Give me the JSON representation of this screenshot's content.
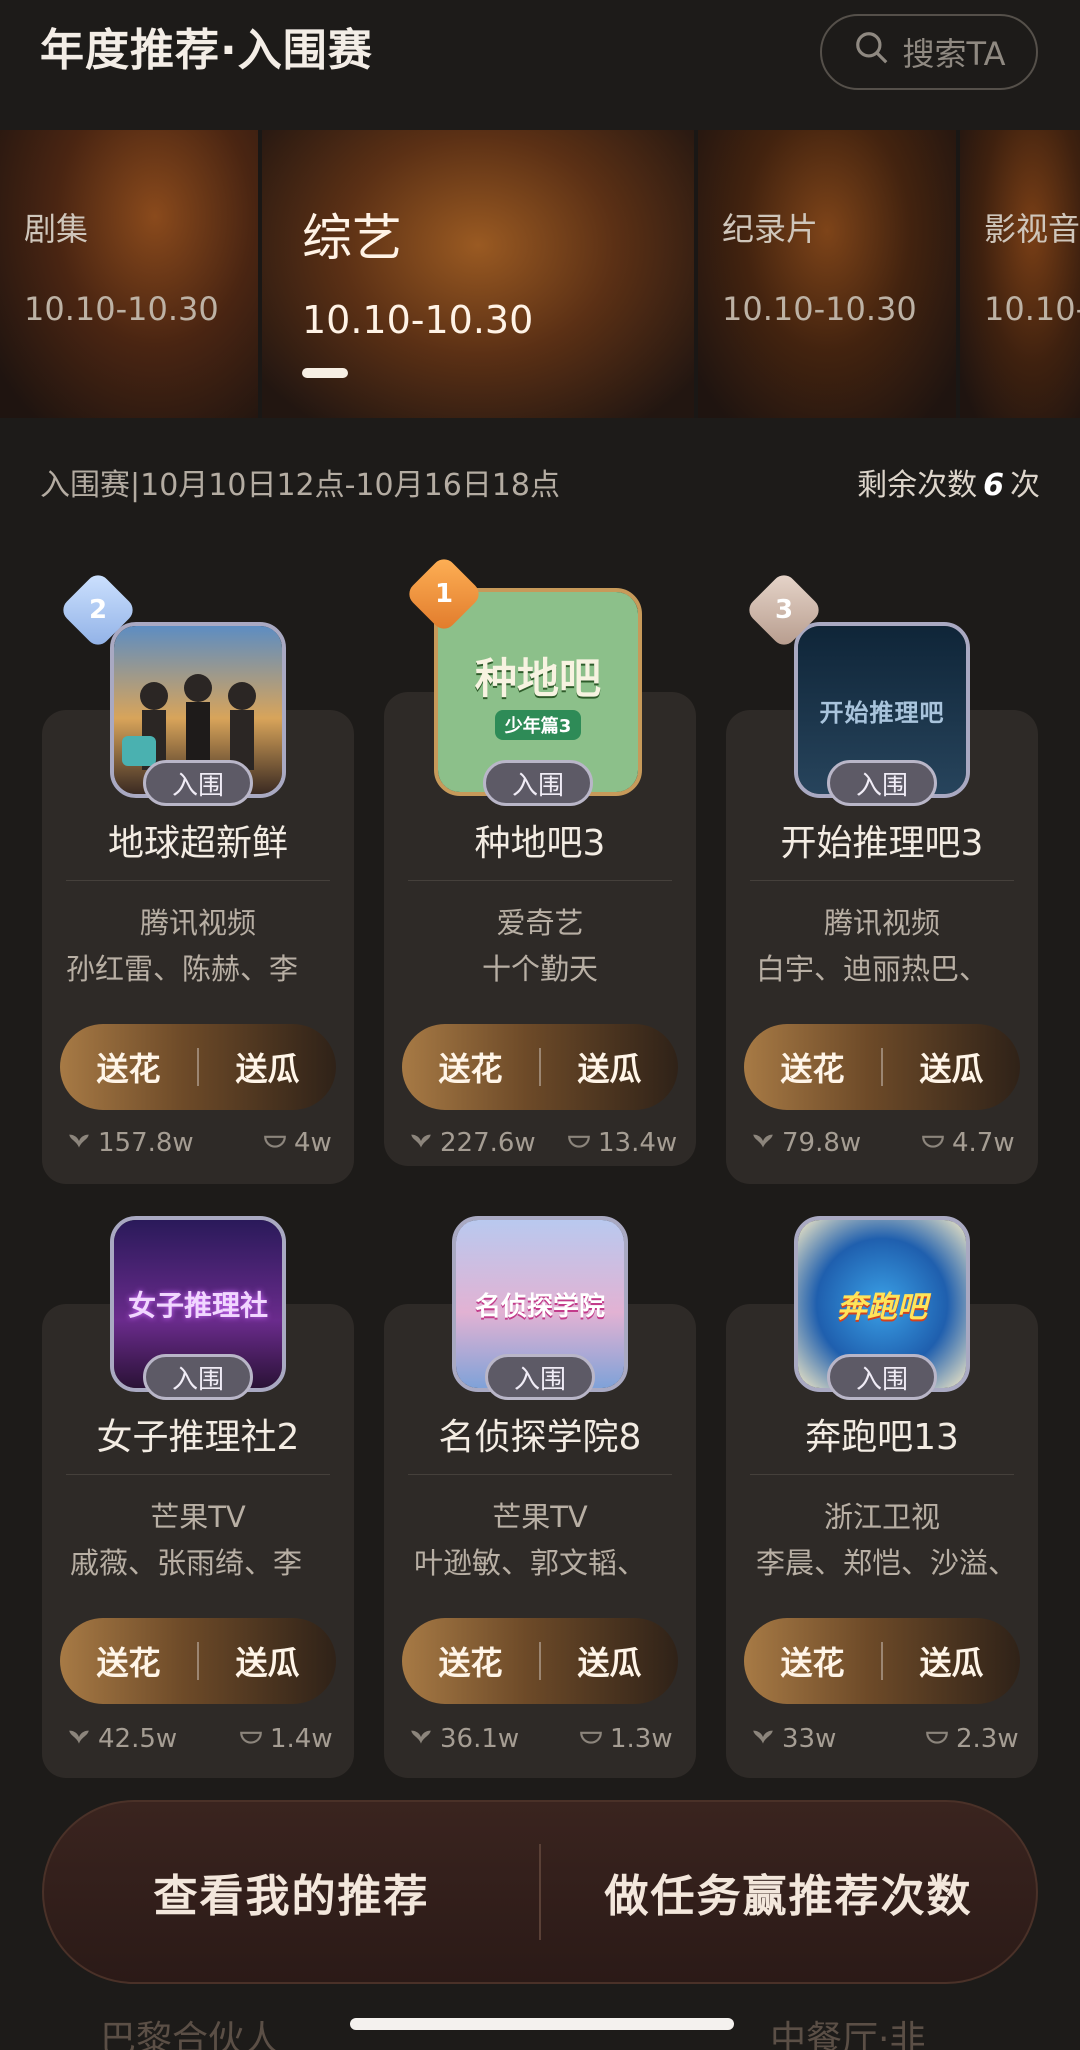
{
  "header": {
    "title": "年度推荐·入围赛",
    "search_label": "搜索TA"
  },
  "tabs": [
    {
      "label": "剧集",
      "date": "10.10-10.30"
    },
    {
      "label": "综艺",
      "date": "10.10-10.30",
      "active": true
    },
    {
      "label": "纪录片",
      "date": "10.10-10.30"
    },
    {
      "label": "影视音",
      "date": "10.10-"
    }
  ],
  "info": {
    "period": "入围赛|10月10日12点-10月16日18点",
    "remaining_label": "剩余次数",
    "remaining_count": "6",
    "remaining_unit": "次"
  },
  "cards": [
    {
      "rank": "2",
      "badge": "入围",
      "title": "地球超新鲜",
      "platform": "腾讯视频",
      "cast": "孙红雷、陈赫、李",
      "flower": "送花",
      "melon": "送瓜",
      "flower_count": "157.8w",
      "melon_count": "4w"
    },
    {
      "rank": "1",
      "badge": "入围",
      "title": "种地吧3",
      "platform": "爱奇艺",
      "cast": "十个勤天",
      "flower": "送花",
      "melon": "送瓜",
      "flower_count": "227.6w",
      "melon_count": "13.4w",
      "poster_text": "种地吧",
      "poster_sub": "少年篇3"
    },
    {
      "rank": "3",
      "badge": "入围",
      "title": "开始推理吧3",
      "platform": "腾讯视频",
      "cast": "白宇、迪丽热巴、",
      "flower": "送花",
      "melon": "送瓜",
      "flower_count": "79.8w",
      "melon_count": "4.7w",
      "poster_text": "开始推理吧"
    },
    {
      "badge": "入围",
      "title": "女子推理社2",
      "platform": "芒果TV",
      "cast": "戚薇、张雨绮、李",
      "flower": "送花",
      "melon": "送瓜",
      "flower_count": "42.5w",
      "melon_count": "1.4w",
      "poster_text": "女子推理社"
    },
    {
      "badge": "入围",
      "title": "名侦探学院8",
      "platform": "芒果TV",
      "cast": "叶逊敏、郭文韬、",
      "flower": "送花",
      "melon": "送瓜",
      "flower_count": "36.1w",
      "melon_count": "1.3w",
      "poster_text": "名侦探学院"
    },
    {
      "badge": "入围",
      "title": "奔跑吧13",
      "platform": "浙江卫视",
      "cast": "李晨、郑恺、沙溢、",
      "flower": "送花",
      "melon": "送瓜",
      "flower_count": "33w",
      "melon_count": "2.3w",
      "poster_text": "奔跑吧"
    }
  ],
  "bottom": {
    "my_recommend": "查看我的推荐",
    "tasks": "做任务赢推荐次数"
  },
  "peek": [
    "巴黎合伙人",
    "",
    "中餐厅·非"
  ],
  "colors": {
    "bg": "#1d1b19",
    "card": "#2e2a27",
    "gold": "#a77a45"
  }
}
